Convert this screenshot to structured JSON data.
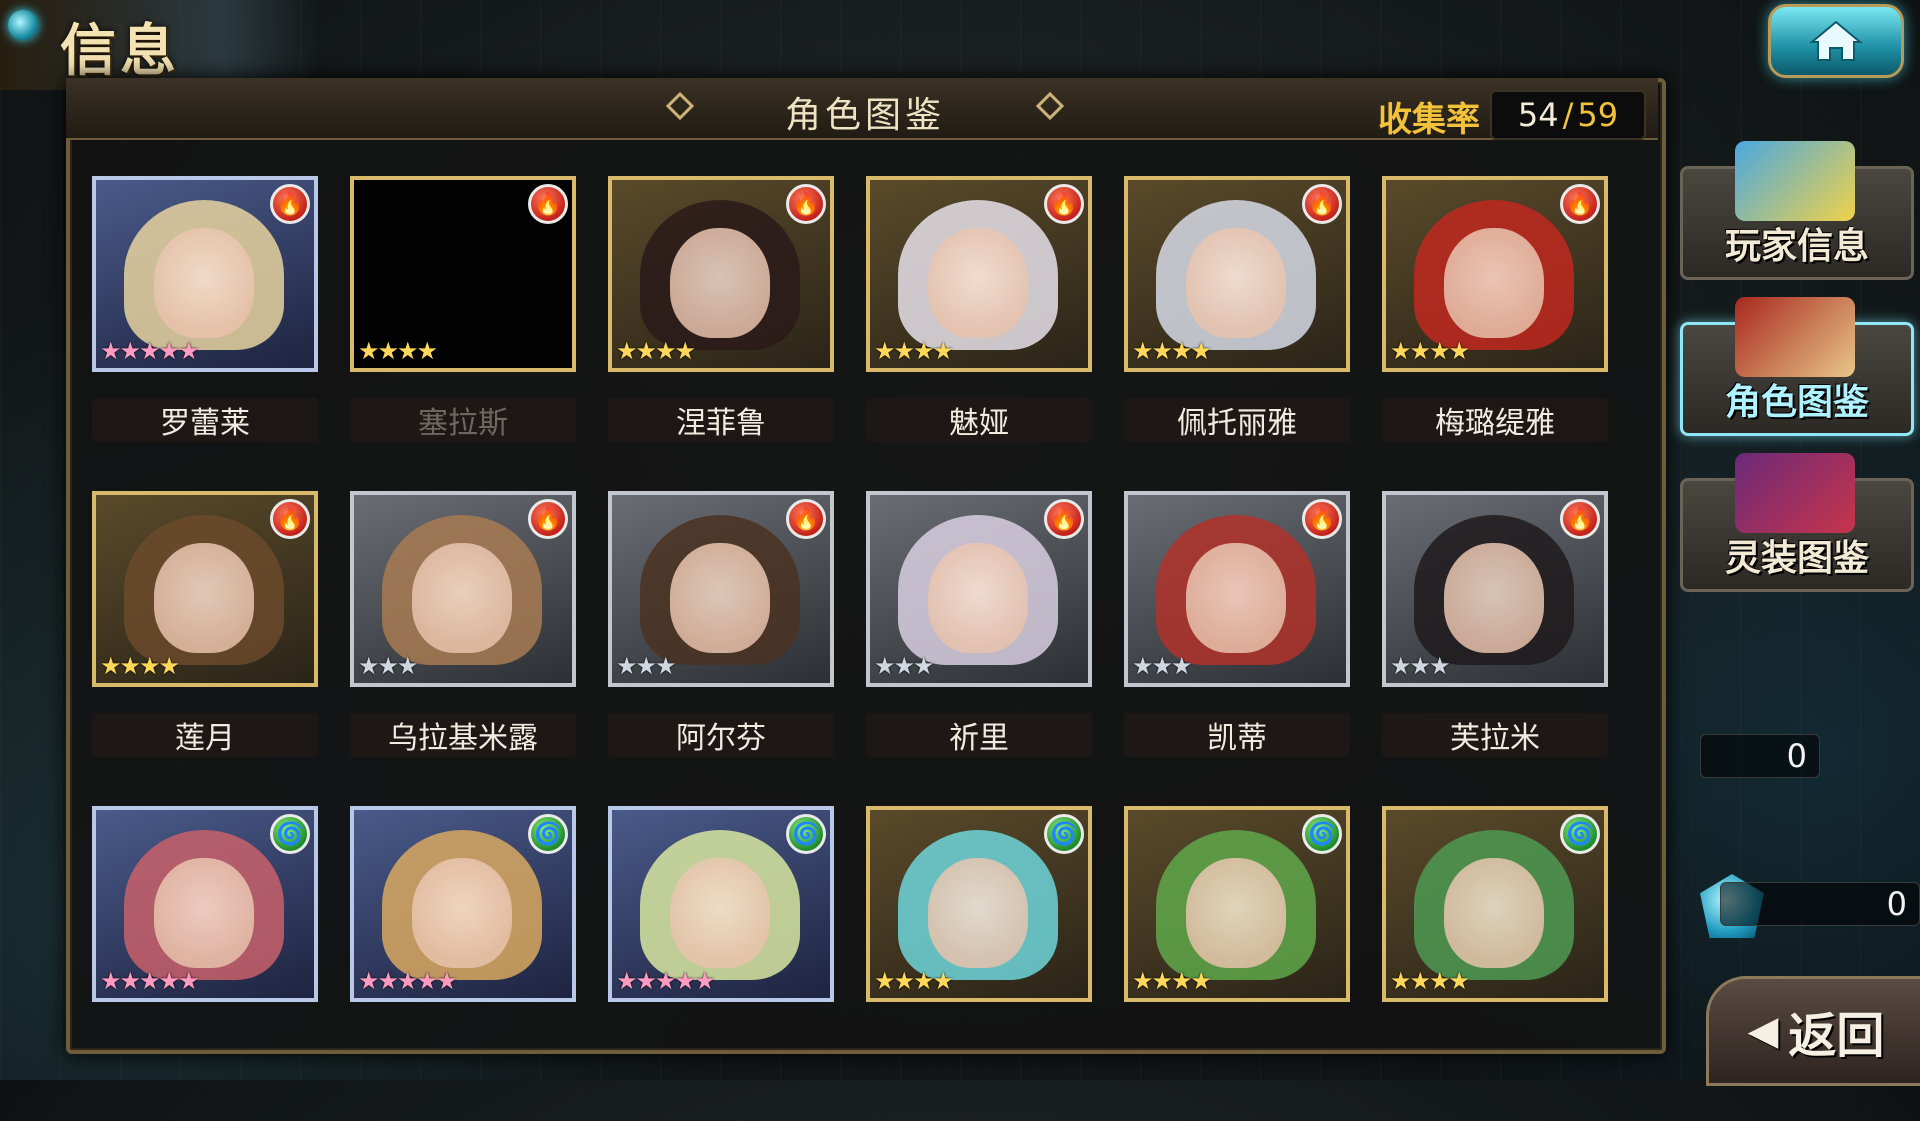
{
  "header": {
    "corner_title": "信息",
    "panel_title": "角色图鉴",
    "collection_label": "收集率",
    "collected": "54",
    "total": "59",
    "separator": "/"
  },
  "side_menu": [
    {
      "label": "玩家信息",
      "active": false
    },
    {
      "label": "角色图鉴",
      "active": true
    },
    {
      "label": "灵装图鉴",
      "active": false
    }
  ],
  "counters": {
    "small_value": "0",
    "gem_value": "0"
  },
  "back_button": {
    "label": "返回",
    "icon": "left-arrow-icon"
  },
  "home_button": {
    "icon": "home-icon"
  },
  "colors": {
    "accent_gold": "#f2c23b",
    "fire": "#c3221b",
    "wind": "#1f8c2c",
    "active_cyan": "#8fe6f5"
  },
  "characters": [
    {
      "name": "罗蕾莱",
      "element": "fire",
      "stars": 5,
      "frame": "rainbow",
      "locked": false,
      "hair": "#e8d3a0"
    },
    {
      "name": "塞拉斯",
      "element": "fire",
      "stars": 4,
      "frame": "gold",
      "locked": true,
      "hair": "#000000"
    },
    {
      "name": "涅菲鲁",
      "element": "fire",
      "stars": 4,
      "frame": "gold",
      "locked": false,
      "hair": "#2a1a1a"
    },
    {
      "name": "魅娅",
      "element": "fire",
      "stars": 4,
      "frame": "gold",
      "locked": false,
      "hair": "#e6e2ea"
    },
    {
      "name": "佩托丽雅",
      "element": "fire",
      "stars": 4,
      "frame": "gold",
      "locked": false,
      "hair": "#d6dbe6"
    },
    {
      "name": "梅璐缇雅",
      "element": "fire",
      "stars": 4,
      "frame": "gold",
      "locked": false,
      "hair": "#c0281e"
    },
    {
      "name": "莲月",
      "element": "fire",
      "stars": 4,
      "frame": "gold",
      "locked": false,
      "hair": "#6b4a2c"
    },
    {
      "name": "乌拉基米露",
      "element": "fire",
      "stars": 3,
      "frame": "silver",
      "locked": false,
      "hair": "#a87b52"
    },
    {
      "name": "阿尔芬",
      "element": "fire",
      "stars": 3,
      "frame": "silver",
      "locked": false,
      "hair": "#4a3322"
    },
    {
      "name": "祈里",
      "element": "fire",
      "stars": 3,
      "frame": "silver",
      "locked": false,
      "hair": "#d8cfe0"
    },
    {
      "name": "凯蒂",
      "element": "fire",
      "stars": 3,
      "frame": "silver",
      "locked": false,
      "hair": "#b2312a"
    },
    {
      "name": "芙拉米",
      "element": "fire",
      "stars": 3,
      "frame": "silver",
      "locked": false,
      "hair": "#1e1a1c"
    },
    {
      "name": "",
      "element": "wind",
      "stars": 5,
      "frame": "rainbow",
      "locked": false,
      "hair": "#c9606a"
    },
    {
      "name": "",
      "element": "wind",
      "stars": 5,
      "frame": "rainbow",
      "locked": false,
      "hair": "#d9a860"
    },
    {
      "name": "",
      "element": "wind",
      "stars": 5,
      "frame": "rainbow",
      "locked": false,
      "hair": "#d8e6a0"
    },
    {
      "name": "",
      "element": "wind",
      "stars": 4,
      "frame": "gold",
      "locked": false,
      "hair": "#6fd6da"
    },
    {
      "name": "",
      "element": "wind",
      "stars": 4,
      "frame": "gold",
      "locked": false,
      "hair": "#5fa84a"
    },
    {
      "name": "",
      "element": "wind",
      "stars": 4,
      "frame": "gold",
      "locked": false,
      "hair": "#4e9a52"
    }
  ]
}
